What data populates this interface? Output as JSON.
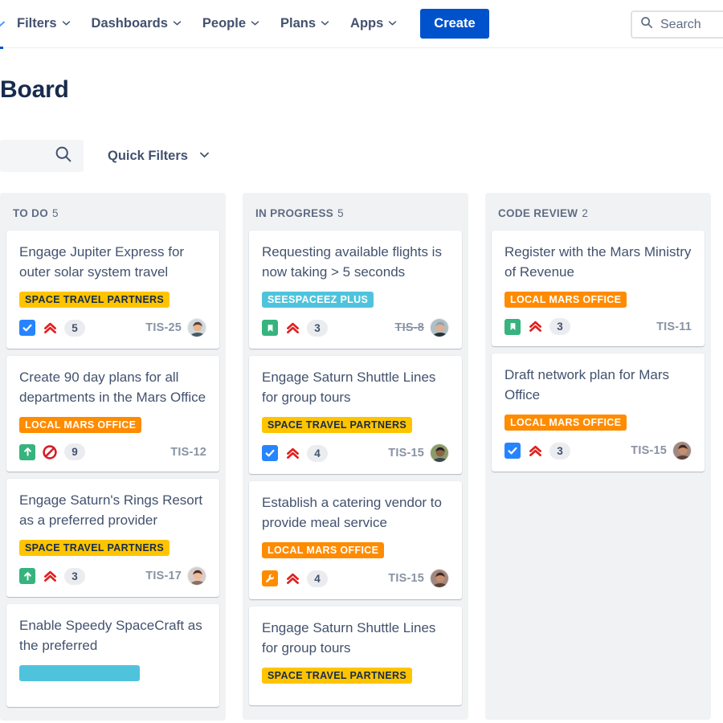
{
  "topnav": {
    "cut_chevron_icon": "chevron-down-icon",
    "items": [
      {
        "label": "Filters",
        "icon": "chevron-down-icon"
      },
      {
        "label": "Dashboards",
        "icon": "chevron-down-icon"
      },
      {
        "label": "People",
        "icon": "chevron-down-icon"
      },
      {
        "label": "Plans",
        "icon": "chevron-down-icon"
      },
      {
        "label": "Apps",
        "icon": "chevron-down-icon"
      }
    ],
    "create_label": "Create",
    "search": {
      "icon": "search-icon",
      "placeholder": "Search",
      "value": ""
    },
    "accent_color": "#0052cc"
  },
  "page": {
    "title": "Board"
  },
  "filterbar": {
    "search": {
      "icon": "search-icon",
      "placeholder": "",
      "value": ""
    },
    "quick_filters_label": "Quick Filters",
    "quick_filters_icon": "chevron-down-icon"
  },
  "colors": {
    "label_yellow": "#ffc400",
    "label_orange": "#ff8b00",
    "label_teal": "#4fc3dc",
    "type_task_blue": "#2684ff",
    "type_story_green": "#36b37e",
    "type_bug_orange": "#ff8b00",
    "priority_red": "#e02020",
    "blocker_red": "#d32029",
    "column_bg": "#f1f2f4",
    "card_bg": "#ffffff",
    "title_navy": "#172b4d"
  },
  "board": {
    "columns": [
      {
        "name": "TO DO",
        "count": "5",
        "cards": [
          {
            "title": "Engage Jupiter Express for outer solar system travel",
            "label": {
              "text": "SPACE TRAVEL PARTNERS",
              "bg": "#ffc400",
              "fg": "#172b4d"
            },
            "type_icon": "task-checkbox-icon",
            "priority_icon": "priority-highest-icon",
            "points": "5",
            "key": "TIS-25",
            "key_resolved": false,
            "avatar": "avatar-male-smiling"
          },
          {
            "title": "Create 90 day plans for all departments in the Mars Office",
            "label": {
              "text": "LOCAL MARS OFFICE",
              "bg": "#ff8b00",
              "fg": "#ffffff"
            },
            "type_icon": "story-arrow-up-icon",
            "priority_icon": "blocker-icon",
            "points": "9",
            "key": "TIS-12",
            "key_resolved": false,
            "avatar": null
          },
          {
            "title": "Engage Saturn's Rings Resort as a preferred provider",
            "label": {
              "text": "SPACE TRAVEL PARTNERS",
              "bg": "#ffc400",
              "fg": "#172b4d"
            },
            "type_icon": "story-arrow-up-icon",
            "priority_icon": "priority-highest-icon",
            "points": "3",
            "key": "TIS-17",
            "key_resolved": false,
            "avatar": "avatar-female-brunette"
          },
          {
            "title": "Enable Speedy SpaceCraft as the preferred",
            "label": {
              "text": "",
              "bg": "#4fc3dc",
              "fg": "#ffffff"
            },
            "type_icon": null,
            "priority_icon": null,
            "points": "",
            "key": "",
            "key_resolved": false,
            "avatar": null,
            "clipped": true
          }
        ]
      },
      {
        "name": "IN PROGRESS",
        "count": "5",
        "cards": [
          {
            "title": "Requesting available flights is now taking > 5 seconds",
            "label": {
              "text": "SEESPACEEZ PLUS",
              "bg": "#4fc3dc",
              "fg": "#ffffff"
            },
            "type_icon": "story-bookmark-icon",
            "priority_icon": "priority-highest-icon",
            "points": "3",
            "key": "TIS-8",
            "key_resolved": true,
            "avatar": "avatar-male-bald"
          },
          {
            "title": "Engage Saturn Shuttle Lines for group tours",
            "label": {
              "text": "SPACE TRAVEL PARTNERS",
              "bg": "#ffc400",
              "fg": "#172b4d"
            },
            "type_icon": "task-checkbox-icon",
            "priority_icon": "priority-highest-icon",
            "points": "4",
            "key": "TIS-15",
            "key_resolved": false,
            "avatar": "avatar-person-hat"
          },
          {
            "title": "Establish a catering vendor to provide meal service",
            "label": {
              "text": "LOCAL MARS OFFICE",
              "bg": "#ff8b00",
              "fg": "#ffffff"
            },
            "type_icon": "maintenance-wrench-icon",
            "priority_icon": "priority-highest-icon",
            "points": "4",
            "key": "TIS-15",
            "key_resolved": false,
            "avatar": "avatar-female-dark"
          },
          {
            "title": "Engage Saturn Shuttle Lines for group tours",
            "label": {
              "text": "SPACE TRAVEL PARTNERS",
              "bg": "#ffc400",
              "fg": "#172b4d"
            },
            "type_icon": null,
            "priority_icon": null,
            "points": "",
            "key": "",
            "key_resolved": false,
            "avatar": null,
            "clipped": true
          }
        ]
      },
      {
        "name": "CODE REVIEW",
        "count": "2",
        "cards": [
          {
            "title": "Register with the Mars Ministry of Revenue",
            "label": {
              "text": "LOCAL MARS OFFICE",
              "bg": "#ff8b00",
              "fg": "#ffffff"
            },
            "type_icon": "story-bookmark-icon",
            "priority_icon": "priority-highest-icon",
            "points": "3",
            "key": "TIS-11",
            "key_resolved": false,
            "avatar": null
          },
          {
            "title": "Draft network plan for Mars Office",
            "label": {
              "text": "LOCAL MARS OFFICE",
              "bg": "#ff8b00",
              "fg": "#ffffff"
            },
            "type_icon": "task-checkbox-icon",
            "priority_icon": "priority-highest-icon",
            "points": "3",
            "key": "TIS-15",
            "key_resolved": false,
            "avatar": "avatar-female-dark"
          }
        ]
      }
    ]
  }
}
